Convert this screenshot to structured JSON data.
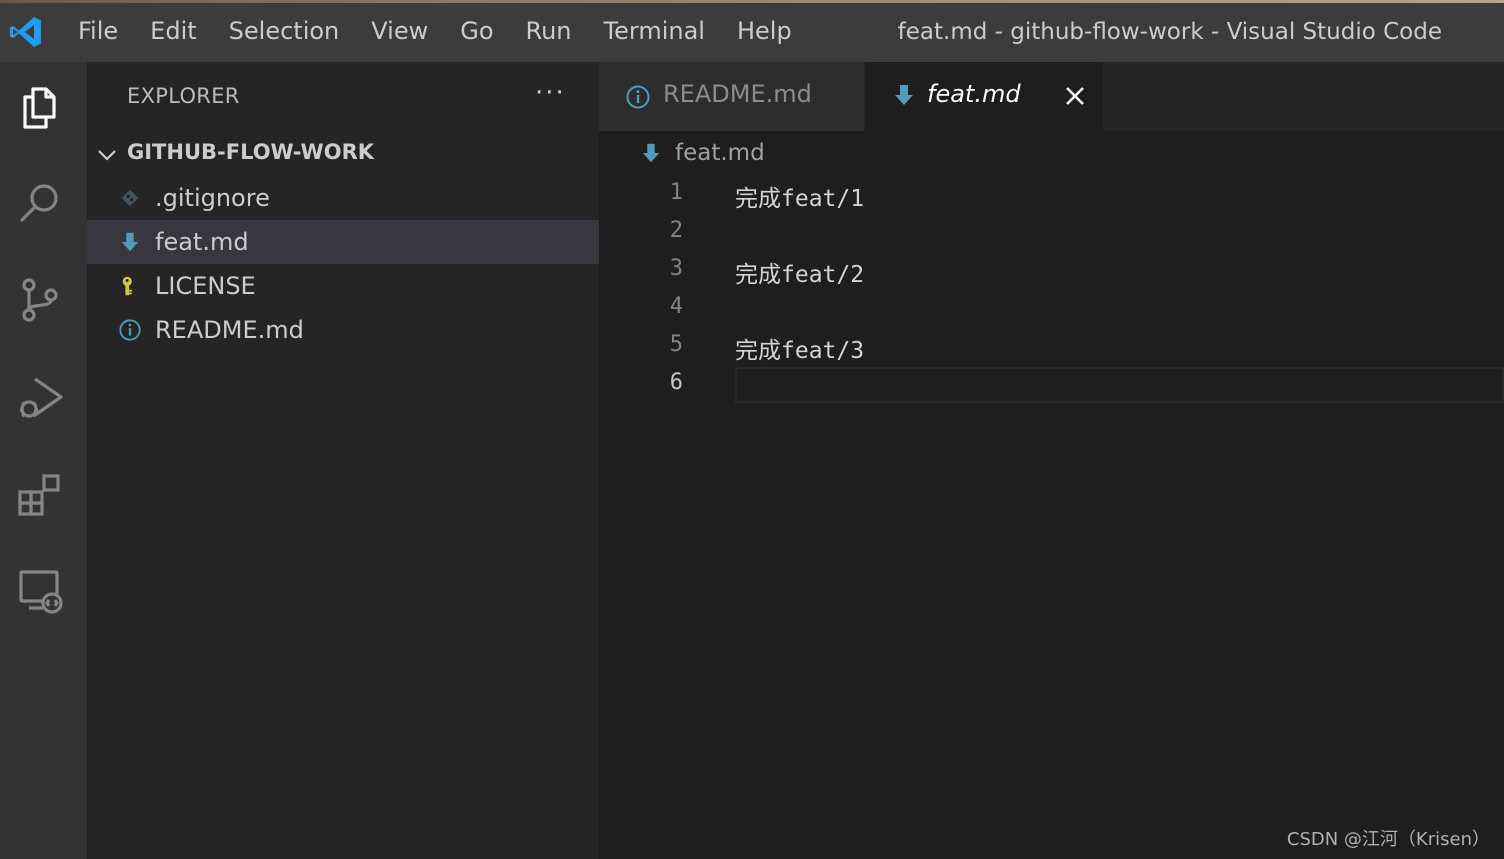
{
  "titlebar": {
    "menu": [
      "File",
      "Edit",
      "Selection",
      "View",
      "Go",
      "Run",
      "Terminal",
      "Help"
    ],
    "window_title": "feat.md - github-flow-work - Visual Studio Code"
  },
  "activitybar": {
    "icons": [
      "explorer-icon",
      "search-icon",
      "source-control-icon",
      "run-debug-icon",
      "extensions-icon",
      "remote-explorer-icon"
    ]
  },
  "sidebar": {
    "title": "EXPLORER",
    "more": "···",
    "folder": "GITHUB-FLOW-WORK",
    "files": [
      {
        "label": ".gitignore",
        "icon": "git-icon",
        "selected": false
      },
      {
        "label": "feat.md",
        "icon": "markdown-download-icon",
        "selected": true
      },
      {
        "label": "LICENSE",
        "icon": "license-key-icon",
        "selected": false
      },
      {
        "label": "README.md",
        "icon": "info-icon",
        "selected": false
      }
    ]
  },
  "editor": {
    "tabs": [
      {
        "label": "README.md",
        "icon": "info-icon",
        "active": false
      },
      {
        "label": "feat.md",
        "icon": "markdown-download-icon",
        "active": true
      }
    ],
    "breadcrumb": "feat.md",
    "lines": [
      {
        "number": "1",
        "text": "完成feat/1"
      },
      {
        "number": "2",
        "text": ""
      },
      {
        "number": "3",
        "text": "完成feat/2"
      },
      {
        "number": "4",
        "text": ""
      },
      {
        "number": "5",
        "text": "完成feat/3"
      },
      {
        "number": "6",
        "text": ""
      }
    ],
    "current_line": "6"
  },
  "watermark": "CSDN @江河（Krisen）",
  "colors": {
    "accent_blue": "#007acc",
    "markdown_icon": "#519aba",
    "license_icon": "#cbcb41"
  }
}
